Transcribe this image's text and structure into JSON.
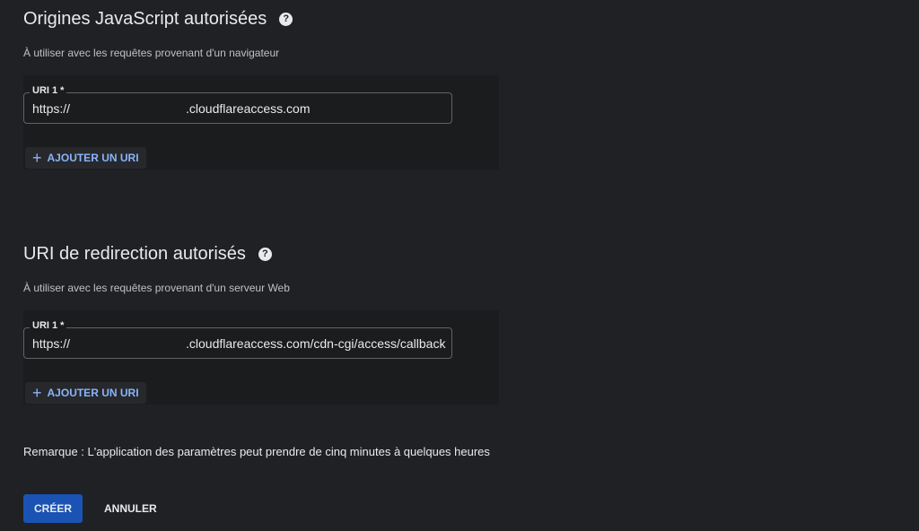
{
  "js_origins": {
    "title": "Origines JavaScript autorisées",
    "help_icon": "question-circle-icon",
    "subtitle": "À utiliser avec les requêtes provenant d'un navigateur",
    "uri_label": "URI 1 *",
    "uri_scheme": "https://",
    "uri_domain": ".cloudflareaccess.com",
    "add_button_label": "AJOUTER UN URI",
    "add_icon": "plus-icon"
  },
  "redirect_uris": {
    "title": "URI de redirection autorisés",
    "help_icon": "question-circle-icon",
    "subtitle": "À utiliser avec les requêtes provenant d'un serveur Web",
    "uri_label": "URI 1 *",
    "uri_scheme": "https://",
    "uri_domain": ".cloudflareaccess.com/cdn-cgi/access/callback",
    "add_button_label": "AJOUTER UN URI",
    "add_icon": "plus-icon"
  },
  "note": "Remarque : L'application des paramètres peut prendre de cinq minutes à quelques heures",
  "actions": {
    "create_label": "CRÉER",
    "cancel_label": "ANNULER"
  },
  "colors": {
    "background": "#202124",
    "primary_button": "#1a53b3",
    "link_blue": "#8ab4f8"
  }
}
